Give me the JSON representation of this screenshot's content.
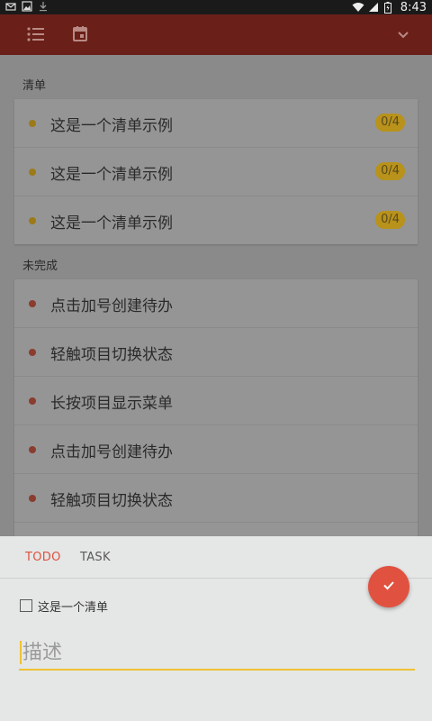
{
  "status_bar": {
    "time": "8:43",
    "icons": [
      "notification-icon",
      "image-icon",
      "download-icon",
      "wifi-icon",
      "signal-icon",
      "battery-icon"
    ]
  },
  "app_bar": {
    "color": "#6a1f19",
    "icons": [
      "list-icon",
      "calendar-icon",
      "chevron-down-icon"
    ]
  },
  "sections": {
    "lists": {
      "label": "清单",
      "items": [
        {
          "text": "这是一个清单示例",
          "badge": "0/4"
        },
        {
          "text": "这是一个清单示例",
          "badge": "0/4"
        },
        {
          "text": "这是一个清单示例",
          "badge": "0/4"
        }
      ]
    },
    "incomplete": {
      "label": "未完成",
      "items": [
        {
          "text": "点击加号创建待办"
        },
        {
          "text": "轻触项目切换状态"
        },
        {
          "text": "长按项目显示菜单"
        },
        {
          "text": "点击加号创建待办"
        },
        {
          "text": "轻触项目切换状态"
        }
      ]
    }
  },
  "sheet": {
    "tabs": [
      {
        "label": "TODO",
        "active": true
      },
      {
        "label": "TASK",
        "active": false
      }
    ],
    "checkbox_label": "这是一个清单",
    "description_placeholder": "描述"
  },
  "colors": {
    "accent_red": "#e0523f",
    "amber": "#b8921a",
    "dot_list": "#9c7a18",
    "dot_todo": "#8a3c2e",
    "input_underline": "#f1c232",
    "tab_inactive": "#5a5a5a"
  }
}
